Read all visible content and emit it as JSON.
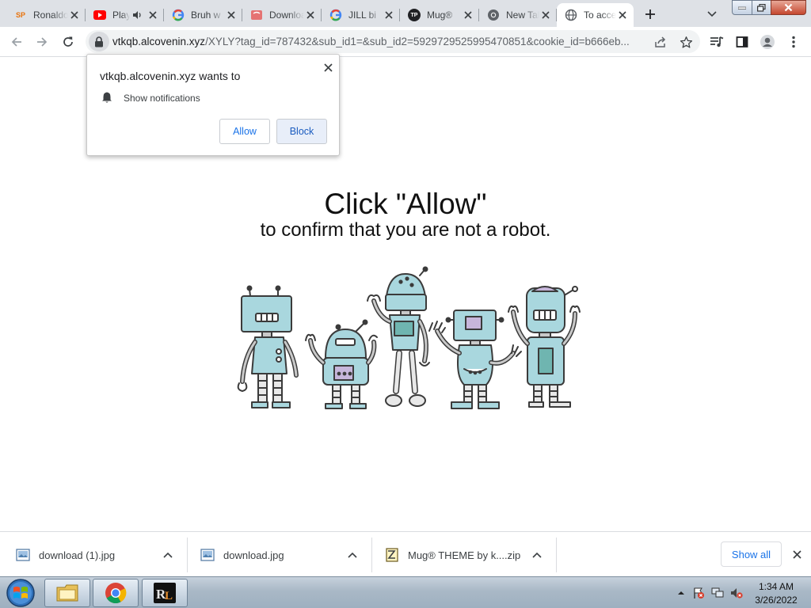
{
  "tabs": [
    {
      "title": "Ronaldo",
      "favicon": "sp-icon",
      "active": false
    },
    {
      "title": "Playing",
      "favicon": "youtube-icon",
      "active": false,
      "audio": true
    },
    {
      "title": "Bruh w",
      "favicon": "google-icon",
      "active": false
    },
    {
      "title": "Download",
      "favicon": "download-site-icon",
      "active": false
    },
    {
      "title": "JILL bi",
      "favicon": "google-icon",
      "active": false
    },
    {
      "title": "Mug®",
      "favicon": "tp-icon",
      "active": false
    },
    {
      "title": "New Tab",
      "favicon": "chrome-icon",
      "active": false
    },
    {
      "title": "To access",
      "favicon": "globe-icon",
      "active": true
    }
  ],
  "address_bar": {
    "host": "vtkqb.alcovenin.xyz",
    "path": "/XYLY?tag_id=787432&sub_id1=&sub_id2=5929729525995470851&cookie_id=b666eb..."
  },
  "permission_prompt": {
    "title": "vtkqb.alcovenin.xyz wants to",
    "item": "Show notifications",
    "allow_label": "Allow",
    "block_label": "Block"
  },
  "page": {
    "headline": "Click \"Allow\"",
    "subline": "to confirm that you are not a robot."
  },
  "downloads": {
    "items": [
      {
        "name": "download (1).jpg",
        "icon": "image-file-icon"
      },
      {
        "name": "download.jpg",
        "icon": "image-file-icon"
      },
      {
        "name": "Mug® THEME by k....zip",
        "icon": "zip-file-icon"
      }
    ],
    "show_all_label": "Show all"
  },
  "taskbar": {
    "apps": [
      "file-explorer",
      "chrome",
      "roblox-launcher"
    ],
    "time": "1:34 AM",
    "date": "3/26/2022"
  },
  "colors": {
    "tab_strip": "#dee1e6",
    "accent_blue": "#1a73e8",
    "robot_body": "#a9d7de",
    "robot_outline": "#3b3b3b"
  }
}
